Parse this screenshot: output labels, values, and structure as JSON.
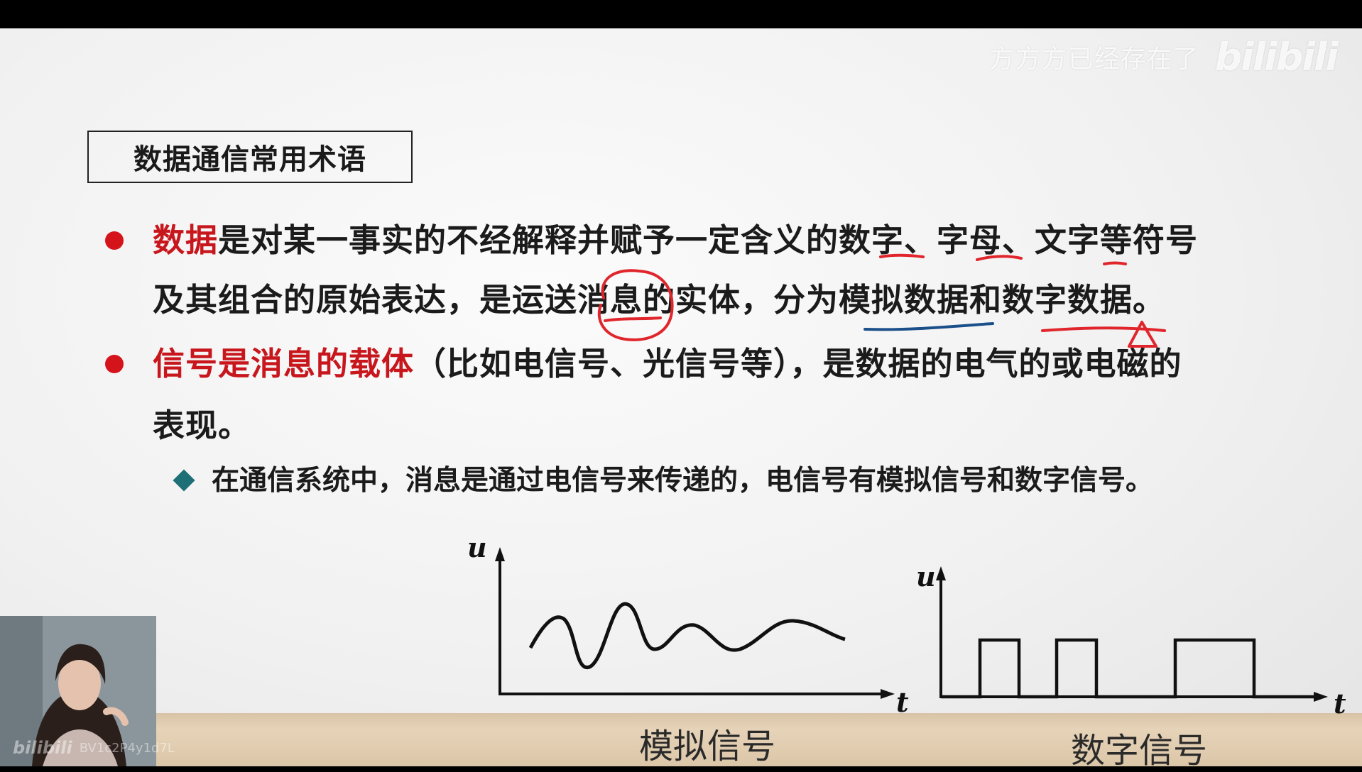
{
  "watermark": {
    "username": "方方方已经存在了",
    "logo": "bilibili"
  },
  "slide": {
    "title": "数据通信常用术语",
    "bullet1": {
      "line1_red": "数据",
      "line1_rest": "是对某一事实的不经解释并赋予一定含义的数字、字母、文字等符号",
      "line2": "及其组合的原始表达，是运送消息的实体，分为模拟数据和数字数据。"
    },
    "bullet2": {
      "line1_red": "信号是消息的载体",
      "line1_rest": "（比如电信号、光信号等），是数据的电气的或电磁的",
      "line2": "表现。"
    },
    "sub_bullet": "在通信系统中，消息是通过电信号来传递的，电信号有模拟信号和数字信号。"
  },
  "figures": {
    "analog": {
      "y_axis": "u",
      "x_axis": "t",
      "caption": "模拟信号"
    },
    "digital": {
      "y_axis": "u",
      "x_axis": "t",
      "caption": "数字信号"
    }
  },
  "webcam": {
    "overlay_logo": "bilibili",
    "overlay_id": "BV1c2P4y1d7L"
  },
  "colors": {
    "emphasis_red": "#c8161d",
    "annotation_red": "#e0262c",
    "diamond_teal": "#1f6f76"
  }
}
